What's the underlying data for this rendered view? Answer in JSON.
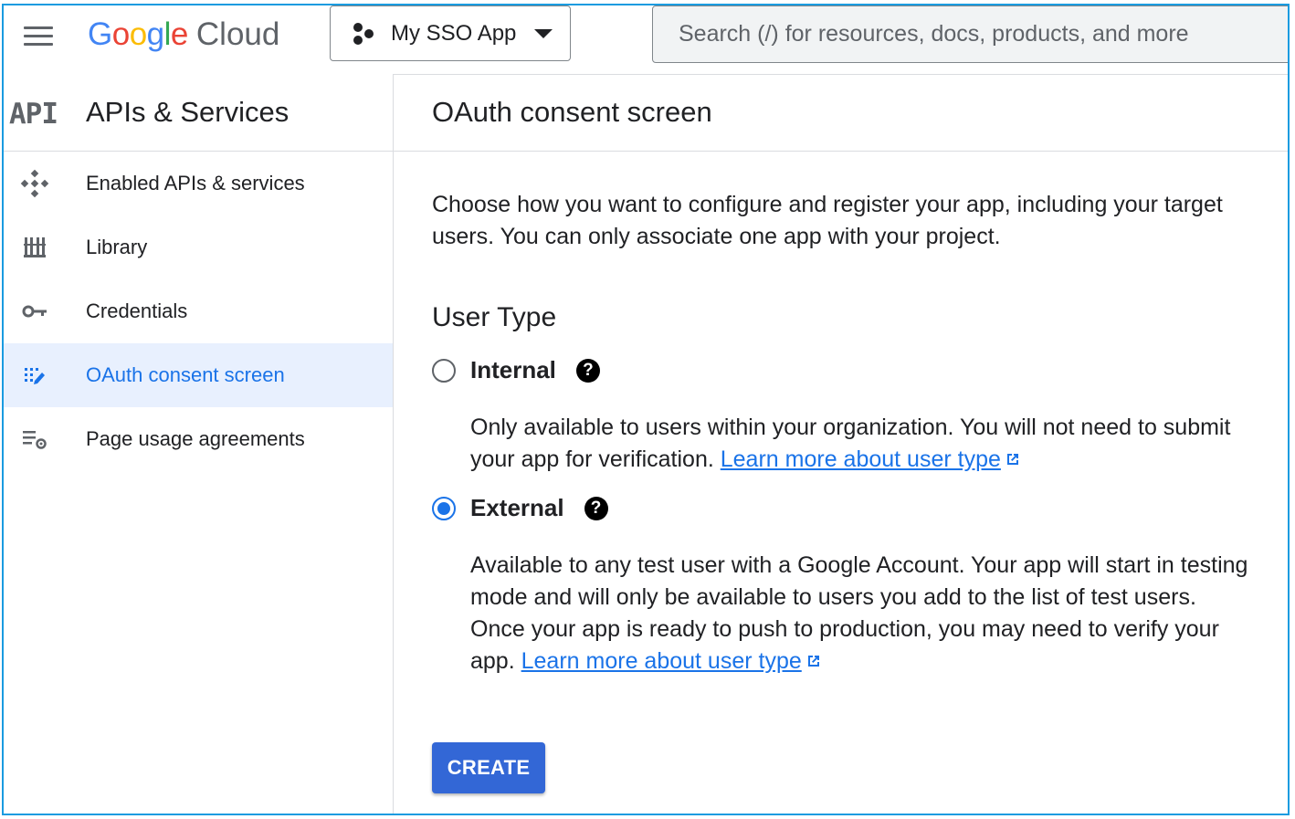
{
  "topbar": {
    "logo_google_letters": [
      {
        "ch": "G",
        "color": "#4285F4"
      },
      {
        "ch": "o",
        "color": "#EA4335"
      },
      {
        "ch": "o",
        "color": "#FBBC05"
      },
      {
        "ch": "g",
        "color": "#4285F4"
      },
      {
        "ch": "l",
        "color": "#34A853"
      },
      {
        "ch": "e",
        "color": "#EA4335"
      }
    ],
    "logo_cloud": "Cloud",
    "project_name": "My SSO App",
    "search_placeholder": "Search (/) for resources, docs, products, and more"
  },
  "sidebar": {
    "logo_text": "API",
    "title": "APIs & Services",
    "items": [
      {
        "label": "Enabled APIs & services",
        "icon": "enabled-apis-icon"
      },
      {
        "label": "Library",
        "icon": "library-icon"
      },
      {
        "label": "Credentials",
        "icon": "key-icon"
      },
      {
        "label": "OAuth consent screen",
        "icon": "consent-screen-icon",
        "active": true
      },
      {
        "label": "Page usage agreements",
        "icon": "settings-list-icon"
      }
    ]
  },
  "main": {
    "title": "OAuth consent screen",
    "intro": "Choose how you want to configure and register your app, including your target users. You can only associate one app with your project.",
    "user_type_title": "User Type",
    "options": [
      {
        "label": "Internal",
        "selected": false,
        "description": "Only available to users within your organization. You will not need to submit your app for verification.",
        "link": "Learn more about user type"
      },
      {
        "label": "External",
        "selected": true,
        "description": "Available to any test user with a Google Account. Your app will start in testing mode and will only be available to users you add to the list of test users. Once your app is ready to push to production, you may need to verify your app.",
        "link": "Learn more about user type"
      }
    ],
    "help_glyph": "?",
    "create_label": "CREATE"
  },
  "colors": {
    "accent": "#1a73e8",
    "button": "#3367d6",
    "active_nav_bg": "#e8f0fe",
    "frame_border": "#1a9be0"
  }
}
